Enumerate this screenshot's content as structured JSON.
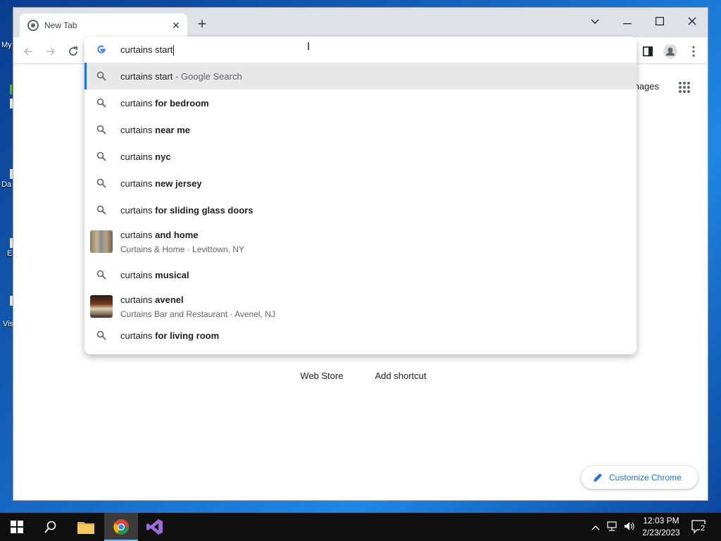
{
  "desktop": {
    "labels": [
      "My",
      "Da",
      "E",
      "Vis"
    ]
  },
  "browser": {
    "tab_title": "New Tab",
    "omnibox_text": "curtains start",
    "suggestions": [
      {
        "prefix": "curtains start",
        "bold": "",
        "desc": " - Google Search",
        "selected": true
      },
      {
        "prefix": "curtains ",
        "bold": "for bedroom"
      },
      {
        "prefix": "curtains ",
        "bold": "near me"
      },
      {
        "prefix": "curtains ",
        "bold": "nyc"
      },
      {
        "prefix": "curtains ",
        "bold": "new jersey"
      },
      {
        "prefix": "curtains ",
        "bold": "for sliding glass doors"
      },
      {
        "prefix": "curtains ",
        "bold": "and home",
        "sub": "Curtains & Home · Levittown, NY"
      },
      {
        "prefix": "curtains ",
        "bold": "musical"
      },
      {
        "prefix": "curtains ",
        "bold": "avenel",
        "sub": "Curtains Bar and Restaurant · Avenel, NJ"
      },
      {
        "prefix": "curtains ",
        "bold": "for living room"
      }
    ],
    "page": {
      "images_link": "mages",
      "shortcuts": [
        "Web Store",
        "Add shortcut"
      ],
      "customize_label": "Customize Chrome"
    }
  },
  "taskbar": {
    "time": "12:03 PM",
    "date": "2/23/2023",
    "notification_count": "2"
  },
  "colors": {
    "accent": "#1a73e8",
    "tabstrip": "#dee1e6",
    "taskbar": "#101010"
  }
}
